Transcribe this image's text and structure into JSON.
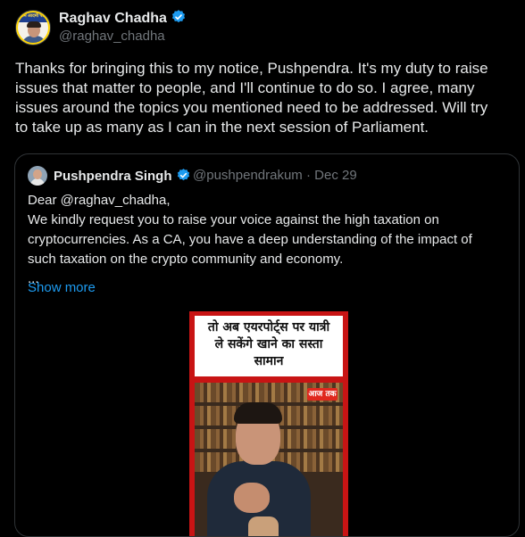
{
  "author": {
    "name": "Raghav Chadha",
    "handle": "@raghav_chadha",
    "avatar_badge_text": "आम आदमी पार्टी"
  },
  "post": {
    "text": "Thanks for bringing this to my notice, Pushpendra. It's my duty to raise\nissues that matter to people, and I'll continue to do so. I agree, many\nissues around the topics you mentioned need to be addressed. Will try\nto take up as many as I can in the next session of Parliament."
  },
  "quoted": {
    "name": "Pushpendra Singh",
    "handle": "@pushpendrakum",
    "separator": "·",
    "date": "Dec 29",
    "text": "Dear @raghav_chadha,\nWe kindly request you to raise your voice against the high taxation on\ncryptocurrencies. As a CA, you have a deep understanding of the impact of\nsuch taxation on the crypto community and economy.\n...",
    "show_more_label": "Show more",
    "media": {
      "caption": "तो अब एयरपोर्ट्स पर यात्री\nले सकेंगे खाने का सस्ता\nसामान",
      "logo_text": "आज तक"
    }
  },
  "colors": {
    "background": "#000000",
    "text": "#e7e9ea",
    "muted": "#71767b",
    "link": "#1d9bf0",
    "verified": "#1d9bf0",
    "border": "#2f3336"
  },
  "icons": {
    "verified": "verified-badge-icon"
  }
}
